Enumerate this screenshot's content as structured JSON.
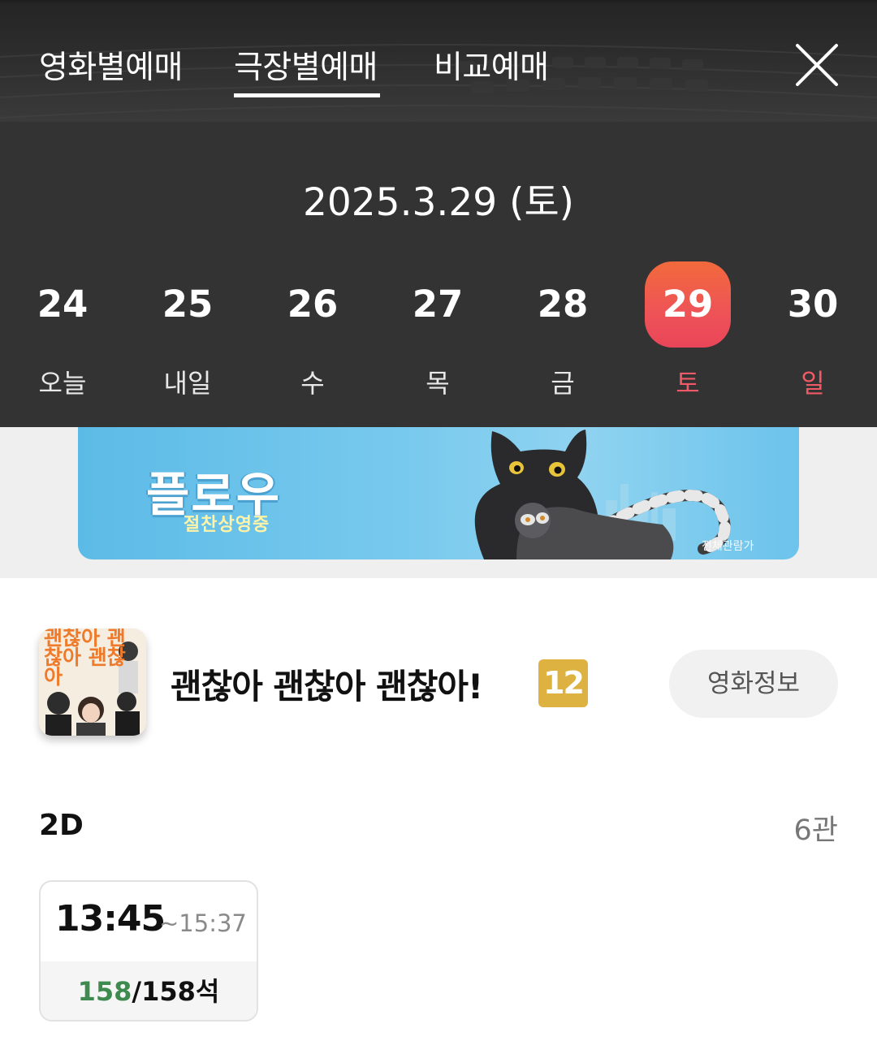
{
  "tabs": [
    {
      "label": "영화별예매",
      "active": false
    },
    {
      "label": "극장별예매",
      "active": true
    },
    {
      "label": "비교예매",
      "active": false
    }
  ],
  "close_icon": "close-icon",
  "selected_date": "2025.3.29 (토)",
  "days": [
    {
      "num": "24",
      "label": "오늘"
    },
    {
      "num": "25",
      "label": "내일"
    },
    {
      "num": "26",
      "label": "수"
    },
    {
      "num": "27",
      "label": "목"
    },
    {
      "num": "28",
      "label": "금"
    },
    {
      "num": "29",
      "label": "토"
    },
    {
      "num": "30",
      "label": "일"
    }
  ],
  "selected_day": "29",
  "banner": {
    "title": "플로우",
    "subtitle": "절찬상영중",
    "rating": "전체관람가"
  },
  "movie": {
    "poster_text": "괜찮아 괜찮아 괜찮아",
    "title": "괜찮아 괜찮아 괜찮아!",
    "age_rating": "12",
    "info_button": "영화정보"
  },
  "showtimes": {
    "format": "2D",
    "hall_count": "6관",
    "items": [
      {
        "start": "13:45",
        "end": "~15:37",
        "seats_left": "158",
        "seats_total": "/158석"
      }
    ]
  },
  "colors": {
    "header_bg": "#333333",
    "accent": "#ee5357",
    "weekend_red": "#f05a66",
    "age_12": "#ddb241",
    "seats_green": "#3f8a4e"
  }
}
